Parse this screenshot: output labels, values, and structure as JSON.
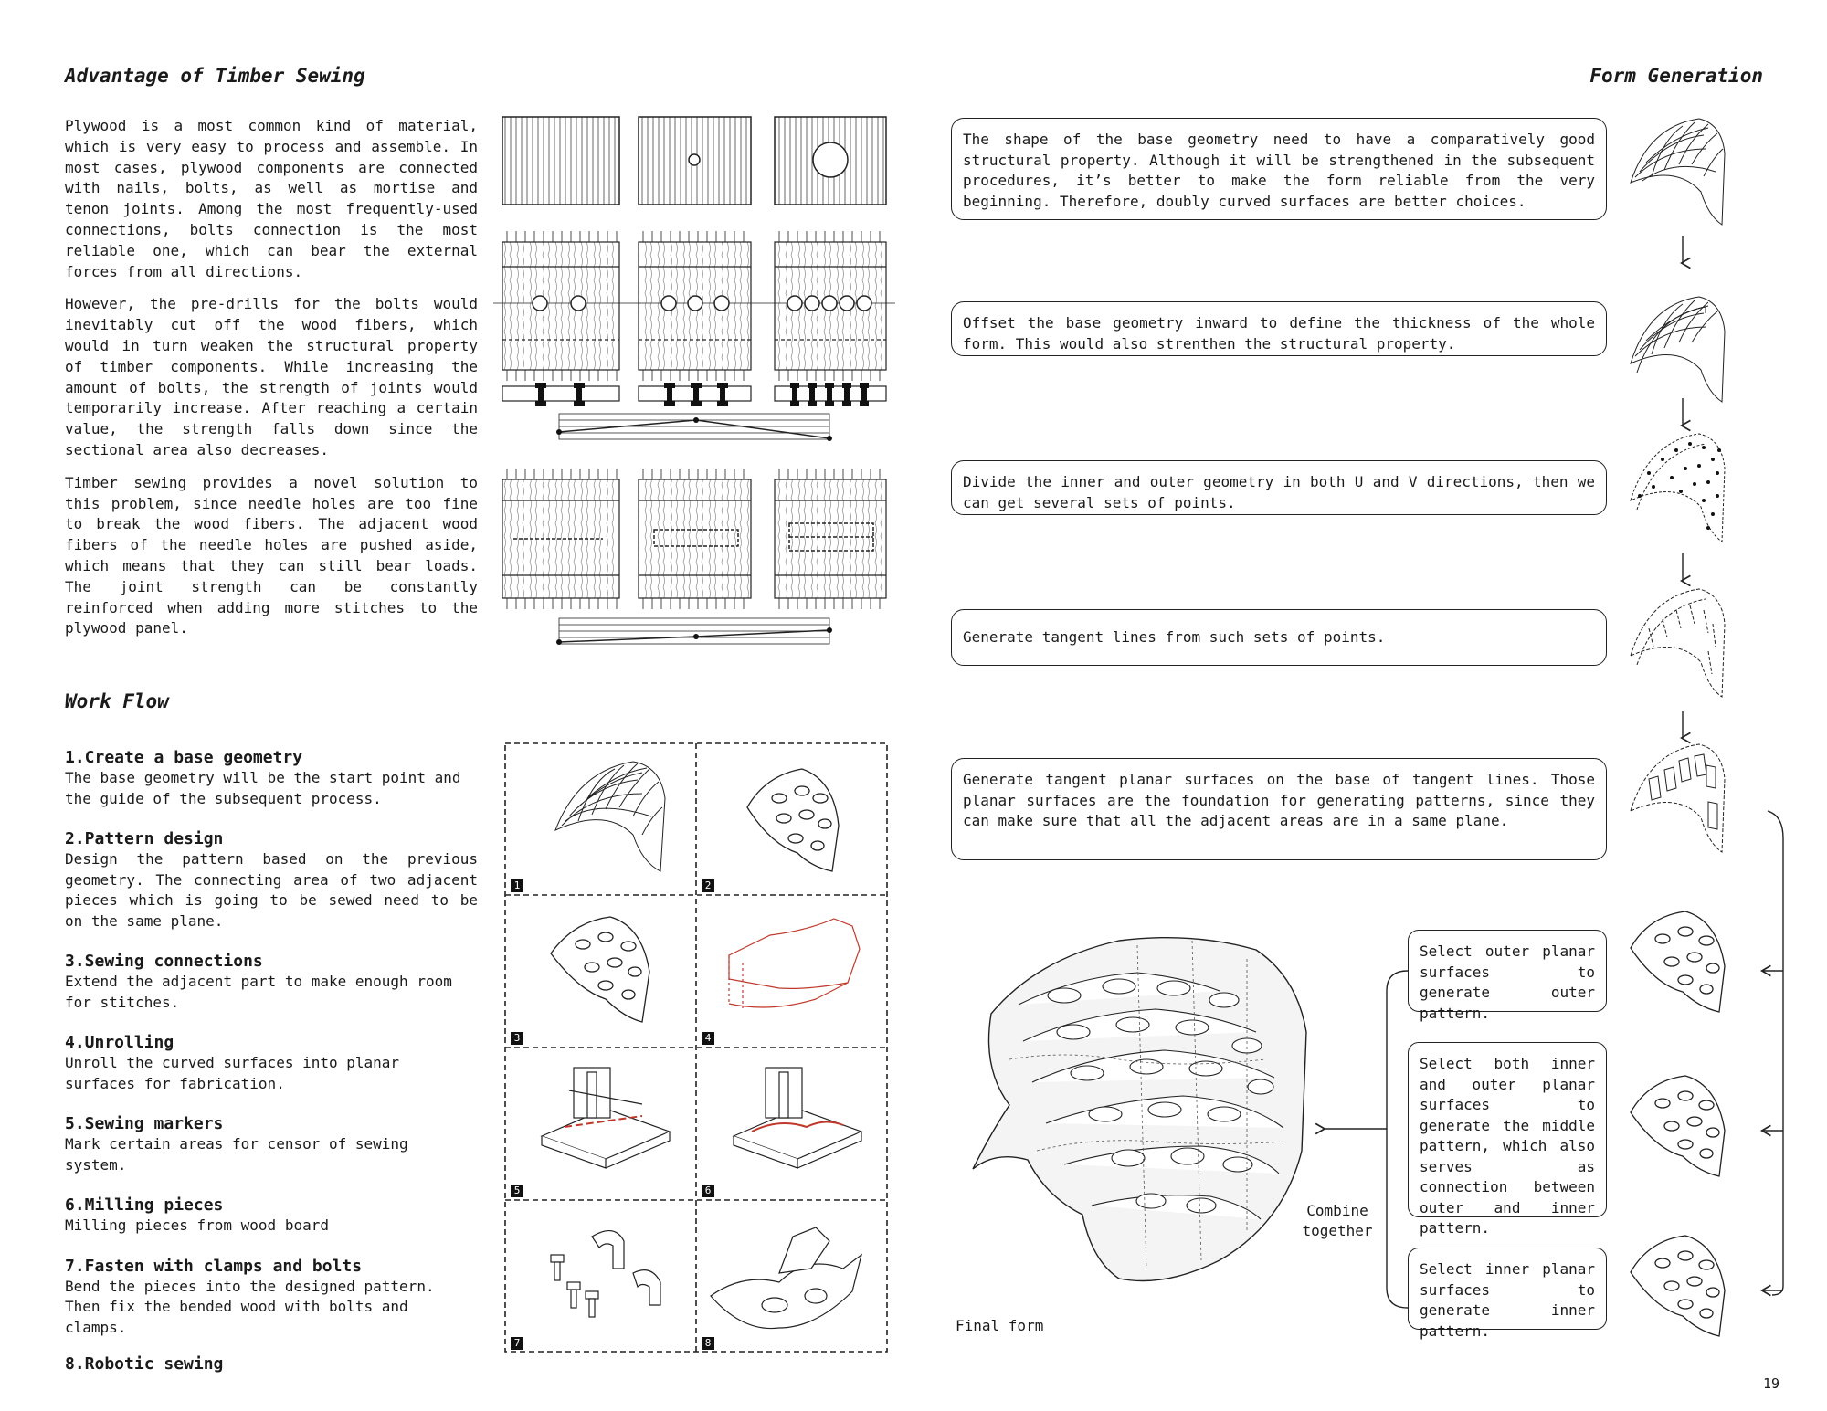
{
  "advantage": {
    "heading": "Advantage of Timber Sewing",
    "paragraphs": [
      "Plywood is a most common kind of material, which is very easy to process and assemble. In most cases, plywood components are connected with nails, bolts, as well as mortise and tenon joints. Among the most frequently-used connections, bolts connection is the most reliable one, which can bear the external forces from all directions.",
      "However, the pre-drills for the bolts would inevitably cut off the wood fibers, which would in turn weaken the structural property of timber components. While increasing the amount of bolts, the strength of joints would temporarily increase. After reaching a certain value, the strength falls down since the sectional area also decreases.",
      "Timber sewing provides a novel solution to this problem, since needle holes are too fine to break the wood fibers. The adjacent wood fibers of the needle holes are pushed aside, which means that they can still bear loads. The joint strength can be constantly reinforced when adding more stitches to the plywood panel."
    ]
  },
  "workflow": {
    "heading": "Work Flow",
    "steps": [
      {
        "title": "1.Create a base geometry",
        "desc": "The base geometry will be the start point and the guide of the subsequent process."
      },
      {
        "title": "2.Pattern design",
        "desc": "Design the pattern based on the previous geometry. The connecting area of two adjacent pieces which is going to be sewed need to be on the same plane."
      },
      {
        "title": "3.Sewing connections",
        "desc": "Extend the adjacent part to make enough room for stitches."
      },
      {
        "title": "4.Unrolling",
        "desc": "Unroll the curved surfaces into planar surfaces for fabrication."
      },
      {
        "title": "5.Sewing markers",
        "desc": "Mark certain areas for censor of sewing system."
      },
      {
        "title": "6.Milling pieces",
        "desc": "Milling pieces from wood board"
      },
      {
        "title": "7.Fasten with clamps and bolts",
        "desc": "Bend the pieces into the designed pattern. Then fix the bended wood with bolts and clamps."
      },
      {
        "title": "8.Robotic sewing",
        "desc": ""
      }
    ],
    "grid_numbers": [
      "1",
      "2",
      "3",
      "4",
      "5",
      "6",
      "7",
      "8"
    ]
  },
  "form_generation": {
    "heading": "Form Generation",
    "steps": [
      "The shape of the base geometry need to have a comparatively good structural property. Although it will be strengthened in the subsequent procedures, it’s better to make the form reliable from the very beginning. Therefore, doubly curved surfaces are better choices.",
      "Offset the base geometry inward to define the thickness of the whole form. This would also strenthen the structural property.",
      "Divide the inner and outer geometry in both U and V directions, then we can get several sets of points.",
      "Generate tangent lines from such sets of points.",
      "Generate tangent planar surfaces on the base of tangent lines. Those planar surfaces are the foundation for generating patterns, since they can make sure that all the adjacent areas are in a same plane."
    ],
    "selections": [
      "Select outer planar surfaces to generate outer pattern.",
      "Select both inner and outer planar surfaces to generate the middle pattern, which also serves as connection between outer and inner pattern.",
      "Select inner planar surfaces to generate inner pattern."
    ],
    "combine_label": "Combine together",
    "final_label": "Final form"
  },
  "page_number": "19",
  "colors": {
    "ink": "#1a1a1a",
    "accent_red": "#c0392b"
  }
}
